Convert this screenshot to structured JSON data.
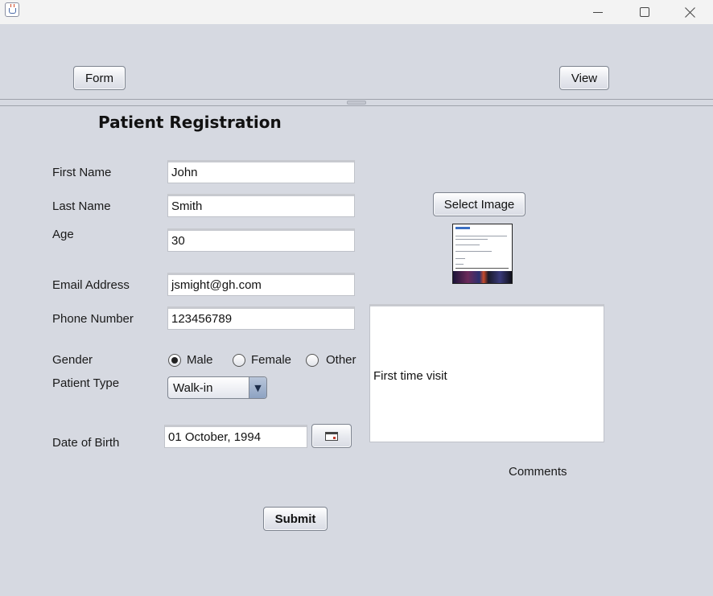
{
  "window": {
    "icon": "java-cup-icon",
    "controls": {
      "minimize": "minimize-icon",
      "maximize": "maximize-icon",
      "close": "close-icon"
    }
  },
  "nav": {
    "form_label": "Form",
    "view_label": "View"
  },
  "form": {
    "title": "Patient Registration",
    "first_name": {
      "label": "First Name",
      "value": "John"
    },
    "last_name": {
      "label": "Last Name",
      "value": "Smith"
    },
    "age": {
      "label": "Age",
      "value": "30"
    },
    "email": {
      "label": "Email Address",
      "value": "jsmight@gh.com"
    },
    "phone": {
      "label": "Phone Number",
      "value": "123456789"
    },
    "gender": {
      "label": "Gender",
      "options": [
        {
          "label": "Male",
          "selected": true
        },
        {
          "label": "Female",
          "selected": false
        },
        {
          "label": "Other",
          "selected": false
        }
      ]
    },
    "patient_type": {
      "label": "Patient Type",
      "value": "Walk-in"
    },
    "dob": {
      "label": "Date of Birth",
      "value": "01 October, 1994",
      "picker_icon": "calendar-icon"
    },
    "select_image_label": "Select Image",
    "comments": {
      "label": "Comments",
      "value": "First time visit"
    },
    "submit_label": "Submit"
  },
  "colors": {
    "background": "#d6d9e1",
    "titlebar": "#f3f3f3",
    "field_bg": "#ffffff",
    "combo_arrow": "#8da2c2"
  }
}
